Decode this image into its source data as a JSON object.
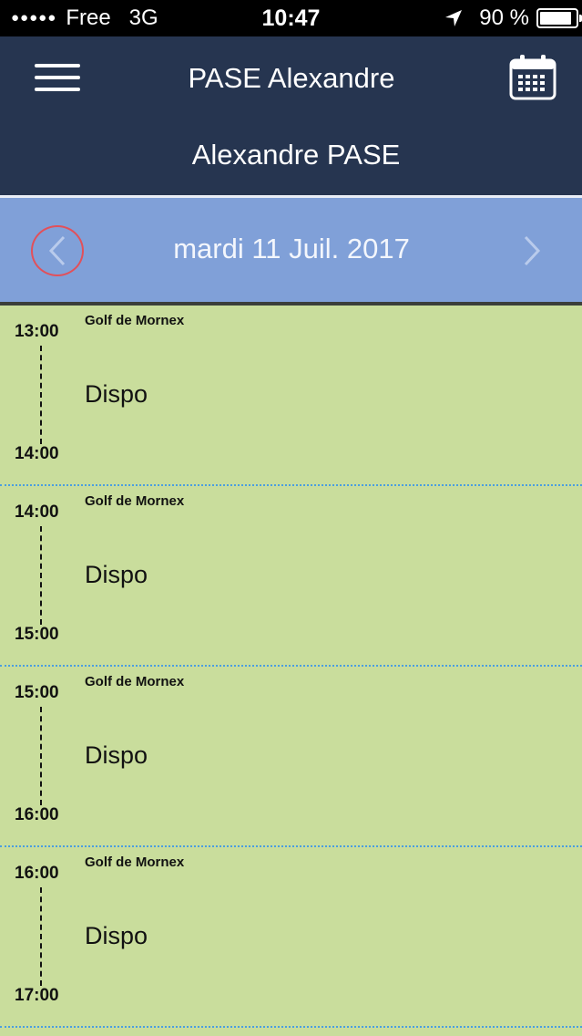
{
  "status_bar": {
    "signal_dots": "●●●●●",
    "carrier": "Free",
    "network": "3G",
    "time": "10:47",
    "battery_percent_label": "90 %",
    "battery_level": 0.9,
    "location_icon": "location-arrow-icon"
  },
  "header": {
    "title": "PASE Alexandre",
    "subtitle": "Alexandre PASE",
    "menu_icon": "hamburger-menu-icon",
    "calendar_icon": "calendar-icon"
  },
  "date_nav": {
    "date": "mardi 11 Juil. 2017",
    "prev_icon": "chevron-left-icon",
    "next_icon": "chevron-right-icon"
  },
  "slots": [
    {
      "start": "13:00",
      "end": "14:00",
      "venue": "Golf de Mornex",
      "status": "Dispo"
    },
    {
      "start": "14:00",
      "end": "15:00",
      "venue": "Golf de Mornex",
      "status": "Dispo"
    },
    {
      "start": "15:00",
      "end": "16:00",
      "venue": "Golf de Mornex",
      "status": "Dispo"
    },
    {
      "start": "16:00",
      "end": "17:00",
      "venue": "Golf de Mornex",
      "status": "Dispo"
    }
  ],
  "colors": {
    "header_bg": "#263550",
    "date_bar_bg": "#80a0d8",
    "slot_bg": "#c9dd9c",
    "prev_ring": "#e2505a",
    "slot_divider": "#4a9ee0"
  }
}
